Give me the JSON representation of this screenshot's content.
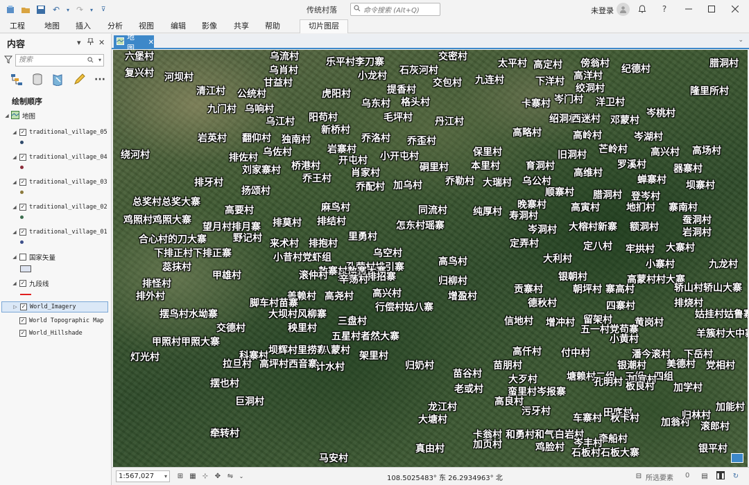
{
  "window": {
    "title": "传统村落",
    "search_placeholder": "命令搜索 (Alt+Q)",
    "user_status": "未登录",
    "help": "?"
  },
  "ribbon": {
    "tabs": [
      "工程",
      "地图",
      "插入",
      "分析",
      "视图",
      "编辑",
      "影像",
      "共享",
      "帮助"
    ],
    "contextual_tab": "切片图层"
  },
  "contents": {
    "title": "内容",
    "search_placeholder": "搜索",
    "section_title": "绘制顺序",
    "map_name": "地图",
    "layers": [
      {
        "name": "traditional_village_05",
        "checked": true,
        "symbol_color": "#2f4a6b"
      },
      {
        "name": "traditional_village_04",
        "checked": true,
        "symbol_color": "#8b2d3a"
      },
      {
        "name": "traditional_village_03",
        "checked": true,
        "symbol_color": "#8c7a3d"
      },
      {
        "name": "traditional_village_02",
        "checked": true,
        "symbol_color": "#3c6e4f"
      },
      {
        "name": "traditional_village_01",
        "checked": true,
        "symbol_color": "#3d4f8a"
      },
      {
        "name": "国家矢量",
        "checked": false,
        "symbol_color": "#dde3f0"
      },
      {
        "name": "九段线",
        "checked": true,
        "symbol_color": "#e02020"
      },
      {
        "name": "World_Imagery",
        "checked": true,
        "selected": true
      },
      {
        "name": "World Topographic Map",
        "checked": true
      },
      {
        "name": "World_Hillshade",
        "checked": true
      }
    ]
  },
  "map_view": {
    "tab_label": "地图",
    "village_labels": [
      "六堡村",
      "复兴村",
      "河坝村",
      "乌流村",
      "乌肖村",
      "甘益村",
      "公统村",
      "清江村",
      "九门村",
      "乌响村",
      "乐平村李刀寨",
      "小龙村",
      "石灰河村",
      "交密村",
      "提香村",
      "虎阳村",
      "交包村",
      "太平村",
      "高定村",
      "傍翁村",
      "纪德村",
      "腊洞村",
      "高洋村",
      "九连村",
      "下洋村",
      "绞洞村",
      "隆里所村",
      "乌东村",
      "格头村",
      "卡寨村",
      "岑门村",
      "洋卫村",
      "阳苟村",
      "毛坪村",
      "乌江村",
      "丹江村",
      "绍洞村",
      "西迷村",
      "邓蒙村",
      "岑桃村",
      "新桥村",
      "高略村",
      "高岭村",
      "岑湖村",
      "岩英村",
      "翻仰村",
      "独南村",
      "乔洛村",
      "乔歪村",
      "绕河村",
      "排佐村",
      "乌佐村",
      "岩寨村",
      "开屯村",
      "小开屯村",
      "保里村",
      "旧洞村",
      "芒岭村",
      "高兴村",
      "高场村",
      "刘家寨村",
      "桥港村",
      "肖家村",
      "硐里村",
      "本里村",
      "育洞村",
      "罗溪村",
      "器寨村",
      "高维村",
      "排牙村",
      "乔王村",
      "乔勒村",
      "大瑞村",
      "乌公村",
      "蝉寨村",
      "坝寨村",
      "扬颂村",
      "乔配村",
      "加乌村",
      "顺寨村",
      "腊洞村",
      "登岑村",
      "总奖村总奖大寨",
      "麻鸟村",
      "晚寨村",
      "高寅村",
      "地扪村",
      "寨南村",
      "高要村",
      "同流村",
      "纯厚村",
      "寿洞村",
      "鸡照村鸡照大寨",
      "望月村排月寨",
      "排莫村",
      "排结村",
      "怎东村瑶寨",
      "岑洞村",
      "大榕村新寨",
      "额洞村",
      "蚕洞村",
      "合心村的刀大寨",
      "野记村",
      "来术村",
      "排抱村",
      "里勇村",
      "定弄村",
      "定八村",
      "牢拱村",
      "大寨村",
      "岩洞村",
      "下排正村下排正寨",
      "小昔村党虾组",
      "乌空村",
      "大利村",
      "小寨村",
      "九龙村",
      "蕊抹村",
      "孔荣村排引寨",
      "高鸟村",
      "敖寨村敖寨大寨",
      "排招村排招寨",
      "排怪村",
      "甲雄村",
      "滚仲村",
      "辛荡村",
      "银朝村",
      "高蒙村村大寨",
      "归柳村",
      "贡寨村",
      "朝坪村",
      "寨高村",
      "轿山村轿山大寨",
      "排外村",
      "盖赖村",
      "高尧村",
      "高兴村",
      "增盈村",
      "德秋村",
      "四寨村",
      "排烧村",
      "脚车村苗寨",
      "行偿村姑八寨",
      "摆鸟村水坳寨",
      "大坝村风柳寨",
      "三盘村",
      "信地村",
      "增冲村",
      "留架村",
      "黄岗村",
      "姑挂村姑鲁寨",
      "交德村",
      "秧里村",
      "五一村党苟寨",
      "小黄村",
      "羊簇村大中寨",
      "五星村者然大寨",
      "甲照村甲照大寨",
      "灯光村",
      "科寨村",
      "坝辉村里捞寨",
      "八蒙村",
      "架里村",
      "高仟村",
      "付中村",
      "潘今滚村",
      "下岳村",
      "拉旦村",
      "高坪村西音寨",
      "计水村",
      "归奶村",
      "苗朋村",
      "银潮村",
      "美德村",
      "党相村",
      "苗谷村",
      "大歹村",
      "塘赖村二组、三组、四组",
      "加宜村",
      "摆也村",
      "老或村",
      "蛮里村岑报寨",
      "孔明村",
      "板良村",
      "加学村",
      "高良村",
      "巨洞村",
      "龙江村",
      "污牙村",
      "田底村",
      "加能村",
      "大塘村",
      "车寨村",
      "秋卡村",
      "加翁村",
      "归林村",
      "滚郎村",
      "卡翁村",
      "和勇村和气寨",
      "白岩村",
      "牵船村",
      "银平村",
      "加牙村",
      "石板村石板大寨",
      "真由村",
      "加页村",
      "鸡脸村",
      "岑丰村",
      "牵转村",
      "马安村"
    ]
  },
  "statusbar": {
    "scale": "1:567,027",
    "coordinates": "108.5025483° 东 26.2934963° 北",
    "selected_features_label": "所选要素",
    "selected_count": "0"
  }
}
